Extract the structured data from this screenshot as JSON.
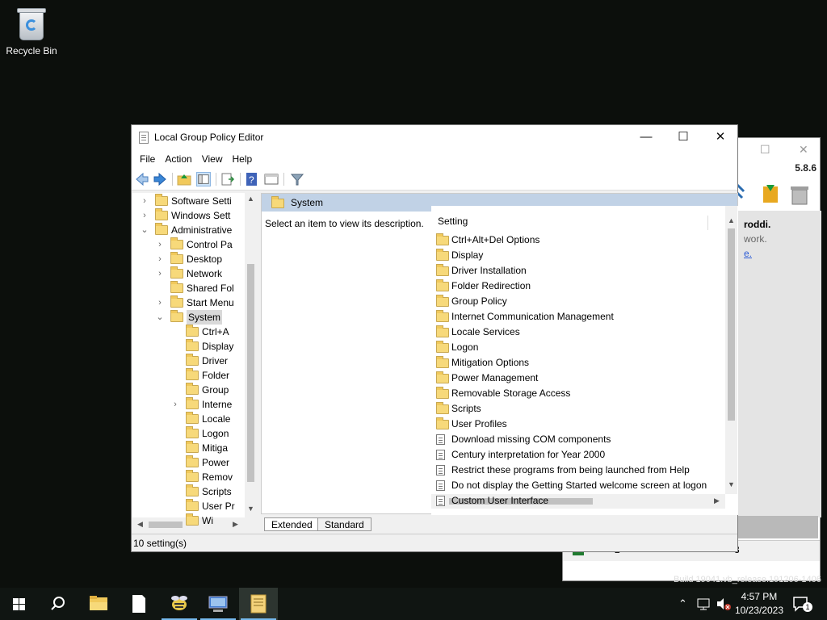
{
  "desktop": {
    "recycle_bin": "Recycle Bin"
  },
  "background_window": {
    "version": "5.8.6",
    "panel_lines": [
      "roddi.",
      "work.",
      "e."
    ],
    "count": "2",
    "count2": "3",
    "build": "Build 19041.vb_release.191206-1406"
  },
  "window": {
    "title": "Local Group Policy Editor",
    "controls": {
      "minimize": "—",
      "maximize": "☐",
      "close": "✕"
    },
    "menu": [
      "File",
      "Action",
      "View",
      "Help"
    ]
  },
  "tree": {
    "items": [
      {
        "label": "Software Setti",
        "level": 1,
        "expander": "›"
      },
      {
        "label": "Windows Sett",
        "level": 1,
        "expander": "›"
      },
      {
        "label": "Administrative",
        "level": 1,
        "expander": "⌄"
      },
      {
        "label": "Control Pa",
        "level": 2,
        "expander": "›"
      },
      {
        "label": "Desktop",
        "level": 2,
        "expander": "›"
      },
      {
        "label": "Network",
        "level": 2,
        "expander": "›"
      },
      {
        "label": "Shared Fol",
        "level": 2,
        "expander": ""
      },
      {
        "label": "Start Menu",
        "level": 2,
        "expander": "›"
      },
      {
        "label": "System",
        "level": 2,
        "expander": "⌄",
        "selected": true
      },
      {
        "label": "Ctrl+A",
        "level": 3,
        "expander": ""
      },
      {
        "label": "Display",
        "level": 3,
        "expander": ""
      },
      {
        "label": "Driver",
        "level": 3,
        "expander": ""
      },
      {
        "label": "Folder",
        "level": 3,
        "expander": ""
      },
      {
        "label": "Group",
        "level": 3,
        "expander": ""
      },
      {
        "label": "Interne",
        "level": 3,
        "expander": "›"
      },
      {
        "label": "Locale",
        "level": 3,
        "expander": ""
      },
      {
        "label": "Logon",
        "level": 3,
        "expander": ""
      },
      {
        "label": "Mitiga",
        "level": 3,
        "expander": ""
      },
      {
        "label": "Power",
        "level": 3,
        "expander": ""
      },
      {
        "label": "Remov",
        "level": 3,
        "expander": ""
      },
      {
        "label": "Scripts",
        "level": 3,
        "expander": ""
      },
      {
        "label": "User Pr",
        "level": 3,
        "expander": ""
      },
      {
        "label": "Wi",
        "level": 3,
        "expander": ""
      }
    ]
  },
  "right_pane": {
    "header": "System",
    "description": "Select an item to view its description.",
    "column_header": "Setting",
    "items": [
      {
        "label": "Ctrl+Alt+Del Options",
        "type": "folder"
      },
      {
        "label": "Display",
        "type": "folder"
      },
      {
        "label": "Driver Installation",
        "type": "folder"
      },
      {
        "label": "Folder Redirection",
        "type": "folder"
      },
      {
        "label": "Group Policy",
        "type": "folder"
      },
      {
        "label": "Internet Communication Management",
        "type": "folder"
      },
      {
        "label": "Locale Services",
        "type": "folder"
      },
      {
        "label": "Logon",
        "type": "folder"
      },
      {
        "label": "Mitigation Options",
        "type": "folder"
      },
      {
        "label": "Power Management",
        "type": "folder"
      },
      {
        "label": "Removable Storage Access",
        "type": "folder"
      },
      {
        "label": "Scripts",
        "type": "folder"
      },
      {
        "label": "User Profiles",
        "type": "folder"
      },
      {
        "label": "Download missing COM components",
        "type": "setting"
      },
      {
        "label": "Century interpretation for Year 2000",
        "type": "setting"
      },
      {
        "label": "Restrict these programs from being launched from Help",
        "type": "setting"
      },
      {
        "label": "Do not display the Getting Started welcome screen at logon",
        "type": "setting"
      },
      {
        "label": "Custom User Interface",
        "type": "setting"
      }
    ]
  },
  "tabs": [
    "Extended",
    "Standard"
  ],
  "status": "10 setting(s)",
  "taskbar": {
    "time": "4:57 PM",
    "date": "10/23/2023",
    "notifications": "1"
  },
  "colors": {
    "header_band": "#c1d2e6",
    "folder": "#f7d97a",
    "taskbar_accent": "#76b9ed"
  }
}
